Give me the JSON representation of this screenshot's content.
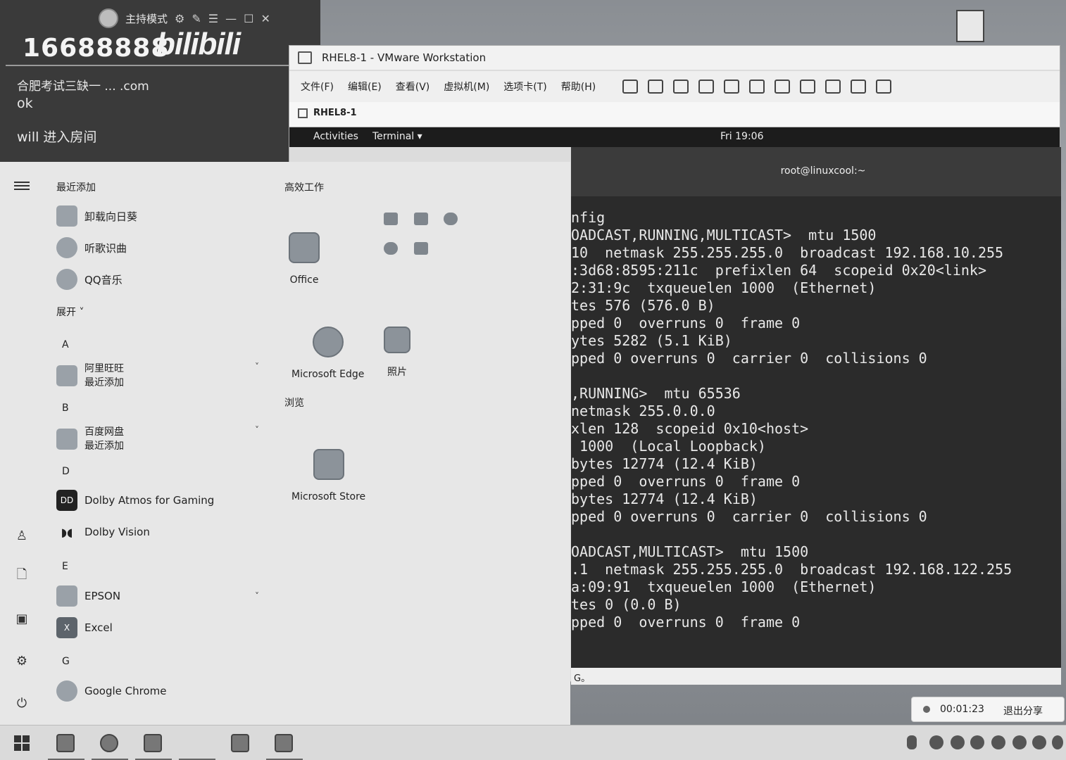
{
  "live": {
    "mode": "主持模式",
    "room_number": "16688888",
    "logo": "bilibili",
    "chat": [
      "合肥考试三缺一 ... .com",
      "ok",
      "will 进入房间"
    ]
  },
  "vmware": {
    "title": "RHEL8-1 - VMware Workstation",
    "menu": [
      "文件(F)",
      "编辑(E)",
      "查看(V)",
      "虚拟机(M)",
      "选项卡(T)",
      "帮助(H)"
    ],
    "tab": "RHEL8-1",
    "gnome": {
      "activities": "Activities",
      "terminal": "Terminal ▾",
      "clock": "Fri 19:06"
    },
    "terminal_title": "root@linuxcool:~",
    "terminal_lines": [
      "nfig",
      "OADCAST,RUNNING,MULTICAST>  mtu 1500",
      "10  netmask 255.255.255.0  broadcast 192.168.10.255",
      ":3d68:8595:211c  prefixlen 64  scopeid 0x20<link>",
      "2:31:9c  txqueuelen 1000  (Ethernet)",
      "tes 576 (576.0 B)",
      "pped 0  overruns 0  frame 0",
      "ytes 5282 (5.1 KiB)",
      "pped 0 overruns 0  carrier 0  collisions 0",
      "",
      ",RUNNING>  mtu 65536",
      "netmask 255.0.0.0",
      "xlen 128  scopeid 0x10<host>",
      " 1000  (Local Loopback)",
      "bytes 12774 (12.4 KiB)",
      "pped 0  overruns 0  frame 0",
      "bytes 12774 (12.4 KiB)",
      "pped 0 overruns 0  carrier 0  collisions 0",
      "",
      "OADCAST,MULTICAST>  mtu 1500",
      ".1  netmask 255.255.255.0  broadcast 192.168.122.255",
      "a:09:91  txqueuelen 1000  (Ethernet)",
      "tes 0 (0.0 B)",
      "pped 0  overruns 0  frame 0"
    ],
    "status": "G。"
  },
  "start": {
    "recent_header": "最近添加",
    "recent": [
      "卸载向日葵",
      "听歌识曲",
      "QQ音乐"
    ],
    "expand": "展开 ˅",
    "groups": [
      {
        "letter": "A",
        "app": "阿里旺旺",
        "sub": "最近添加"
      },
      {
        "letter": "B",
        "app": "百度网盘",
        "sub": "最近添加"
      },
      {
        "letter": "D",
        "apps": [
          "Dolby Atmos for Gaming",
          "Dolby Vision"
        ]
      },
      {
        "letter": "E",
        "apps": [
          "EPSON",
          "Excel"
        ]
      },
      {
        "letter": "G",
        "apps": [
          "Google Chrome"
        ]
      }
    ],
    "productivity_header": "高效工作",
    "tiles": {
      "office": "Office",
      "edge": "Microsoft Edge",
      "photos": "照片",
      "store": "Microsoft Store"
    },
    "browse_header": "浏览"
  },
  "recording": {
    "time": "00:01:23",
    "exit": "退出分享"
  }
}
